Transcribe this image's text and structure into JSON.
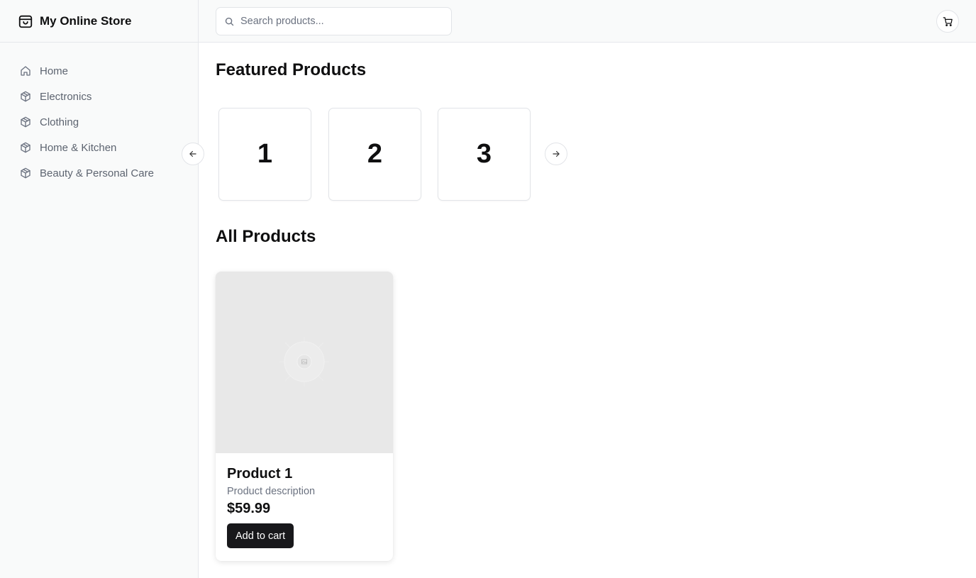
{
  "brand": {
    "name": "My Online Store",
    "icon": "store-icon"
  },
  "sidebar": {
    "items": [
      {
        "label": "Home",
        "icon": "home-icon"
      },
      {
        "label": "Electronics",
        "icon": "package-icon"
      },
      {
        "label": "Clothing",
        "icon": "package-icon"
      },
      {
        "label": "Home & Kitchen",
        "icon": "package-icon"
      },
      {
        "label": "Beauty & Personal Care",
        "icon": "package-icon"
      }
    ]
  },
  "header": {
    "search": {
      "placeholder": "Search products...",
      "value": ""
    },
    "cart_icon": "shopping-cart-icon"
  },
  "main": {
    "featured_title": "Featured Products",
    "featured_slides": [
      "1",
      "2",
      "3"
    ],
    "all_title": "All Products",
    "products": [
      {
        "title": "Product 1",
        "description": "Product description",
        "price": "$59.99",
        "button": "Add to cart",
        "image_icon": "image-placeholder-icon"
      }
    ]
  },
  "colors": {
    "sidebar_bg": "#f9fafa",
    "border": "#e5e7eb",
    "text_muted": "#5d6470",
    "button_dark": "#18181b",
    "image_bg": "#e8e8e8"
  }
}
